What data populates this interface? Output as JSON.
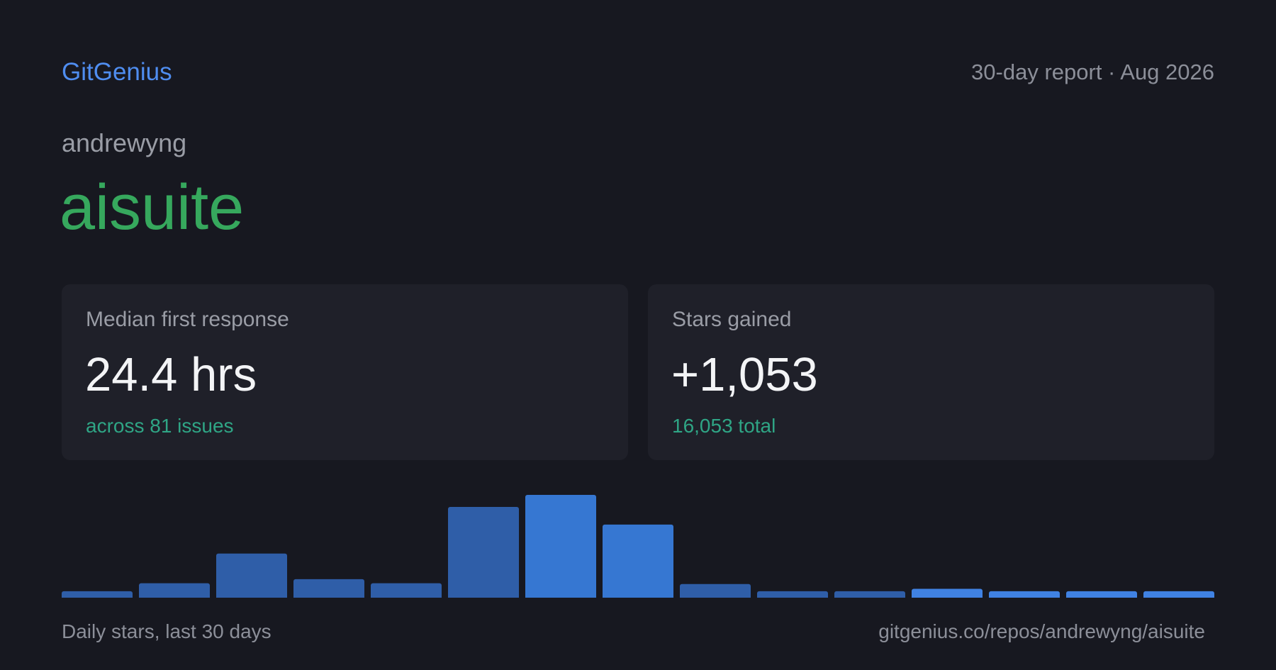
{
  "header": {
    "brand": "GitGenius",
    "report_meta": "30-day report · Aug 2026"
  },
  "repo": {
    "owner": "andrewyng",
    "name": "aisuite"
  },
  "cards": {
    "response": {
      "label": "Median first response",
      "value": "24.4 hrs",
      "sub": "across 81 issues"
    },
    "stars": {
      "label": "Stars gained",
      "value": "+1,053",
      "sub": "16,053 total"
    }
  },
  "footer": {
    "caption": "Daily stars, last 30 days",
    "url": "gitgenius.co/repos/andrewyng/aisuite"
  },
  "colors": {
    "brand": "#4f8df0",
    "repo": "#36a85d",
    "subtext": "#2fa585",
    "bar_dark": "#2f5ea8",
    "bar_light": "#3677d2",
    "bar_bright": "#4082e3"
  },
  "chart_data": {
    "type": "bar",
    "values": [
      8,
      18,
      55,
      23,
      18,
      113,
      128,
      91,
      17,
      8,
      8,
      11,
      8,
      8,
      8
    ],
    "ylim": [
      0,
      128
    ],
    "grid": false,
    "caption_text": "Daily stars, last 30 days"
  }
}
